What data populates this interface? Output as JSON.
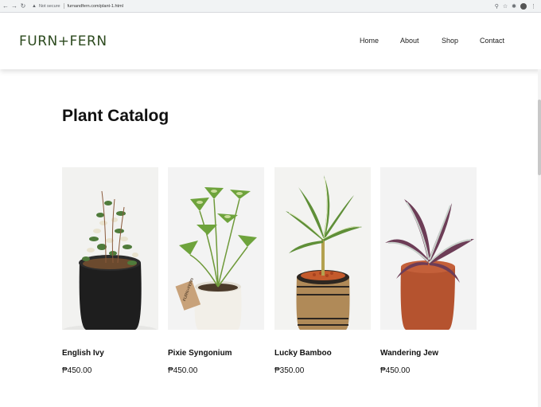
{
  "browser": {
    "security_label": "Not secure",
    "url": "furnandfern.com/plant-1.html",
    "icons": [
      "back-arrow-icon",
      "forward-arrow-icon",
      "reload-icon",
      "warning-icon",
      "zoom-icon",
      "star-icon",
      "extensions-icon",
      "profile-avatar-icon",
      "more-menu-icon"
    ]
  },
  "site": {
    "logo": "FURN+FERN",
    "brand_color": "#2c4a1e",
    "nav": [
      {
        "label": "Home"
      },
      {
        "label": "About"
      },
      {
        "label": "Shop"
      },
      {
        "label": "Contact"
      }
    ]
  },
  "catalog": {
    "title": "Plant Catalog",
    "products": [
      {
        "name": "English Ivy",
        "price": "₱450.00",
        "pot_color": "#1e1e1e",
        "image": "english-ivy-plant"
      },
      {
        "name": "Pixie Syngonium",
        "price": "₱450.00",
        "pot_color": "#f2efe8",
        "image": "pixie-syngonium-plant",
        "tag": "FURN+FERN"
      },
      {
        "name": "Lucky Bamboo",
        "price": "₱350.00",
        "pot_color": "#b08a58",
        "image": "lucky-bamboo-plant"
      },
      {
        "name": "Wandering Jew",
        "price": "₱450.00",
        "pot_color": "#b5532f",
        "image": "wandering-jew-plant"
      }
    ]
  }
}
